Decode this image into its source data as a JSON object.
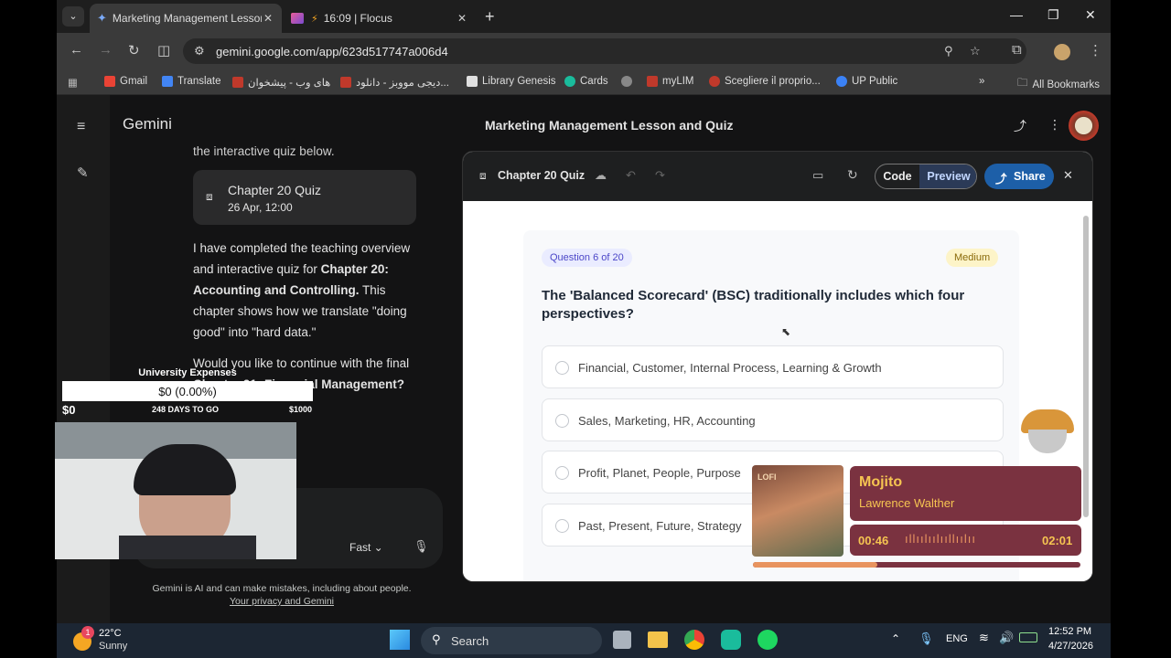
{
  "browser": {
    "tabs": [
      {
        "title": "Marketing Management Lesson",
        "close": "✕"
      },
      {
        "title": "16:09 | Flocus",
        "close": "✕"
      }
    ],
    "new_tab": "+",
    "url": "gemini.google.com/app/623d517747a006d4",
    "window_controls": {
      "minimize": "—",
      "restore": "❐",
      "close": "✕"
    },
    "bookmarks": [
      {
        "label": "Gmail",
        "color": "#ea4335"
      },
      {
        "label": "Translate",
        "color": "#4285f4"
      },
      {
        "label": "های وب - پیشخوان",
        "color": "#c0392b"
      },
      {
        "label": "دیجی مووبز - دانلود...",
        "color": "#c0392b"
      },
      {
        "label": "Library Genesis",
        "color": "#e0e0e0"
      },
      {
        "label": "Cards",
        "color": "#1abc9c"
      },
      {
        "label": "",
        "color": "#888888"
      },
      {
        "label": "myLIM",
        "color": "#c0392b"
      },
      {
        "label": "Scegliere il proprio...",
        "color": "#c0392b"
      },
      {
        "label": "UP Public",
        "color": "#3b82f6"
      }
    ],
    "all_bookmarks": "All Bookmarks"
  },
  "gemini": {
    "app_name": "Gemini",
    "conversation_title": "Marketing Management Lesson and Quiz",
    "chat": {
      "cutoff_line": "the interactive quiz below.",
      "chip": {
        "title": "Chapter 20 Quiz",
        "date": "26 Apr, 12:00"
      },
      "para1_a": "I have completed the teaching overview and interactive quiz for ",
      "para1_b": "Chapter 20: Accounting and Controlling.",
      "para1_c": " This chapter shows how we translate \"doing good\" into \"hard data.\"",
      "para2_a": "Would you like to continue with the final ",
      "para2_b": "Chapter 21: Financial Management?",
      "model_label": "Fast",
      "disclaimer": "Gemini is AI and can make mistakes, including about people.",
      "privacy_link": "Your privacy and Gemini"
    },
    "canvas": {
      "title": "Chapter 20 Quiz",
      "code_tab": "Code",
      "preview_tab": "Preview",
      "share": "Share",
      "question_badge": "Question 6 of 20",
      "difficulty": "Medium",
      "question": "The 'Balanced Scorecard' (BSC) traditionally includes which four perspectives?",
      "options": [
        "Financial, Customer, Internal Process, Learning & Growth",
        "Sales, Marketing, HR, Accounting",
        "Profit, Planet, People, Purpose",
        "Past, Present, Future, Strategy"
      ]
    }
  },
  "overlays": {
    "expenses": {
      "title": "University Expenses",
      "value": "$0 (0.00%)",
      "min": "$0",
      "days": "248 DAYS TO GO",
      "max": "$1000",
      "progress": 0.0
    },
    "music": {
      "song": "Mojito",
      "artist": "Lawrence Walther",
      "elapsed": "00:46",
      "total": "02:01",
      "progress": 0.38,
      "album_text": "LOFI"
    }
  },
  "taskbar": {
    "weather_temp": "22°C",
    "weather_desc": "Sunny",
    "weather_badge": "1",
    "search": "Search",
    "lang": "ENG",
    "time": "12:52 PM",
    "date": "4/27/2026"
  }
}
